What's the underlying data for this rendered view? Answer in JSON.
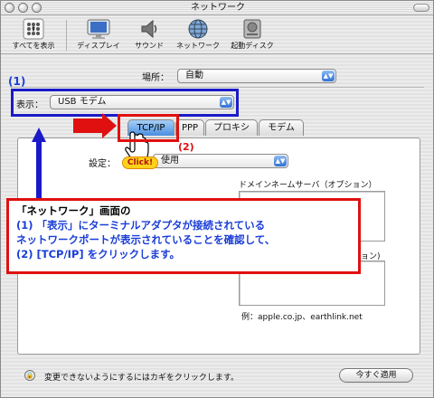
{
  "window": {
    "title": "ネットワーク"
  },
  "toolbar": {
    "show_all": "すべてを表示",
    "items": [
      {
        "label": "ディスプレイ",
        "icon": "display-icon"
      },
      {
        "label": "サウンド",
        "icon": "speaker-icon"
      },
      {
        "label": "ネットワーク",
        "icon": "network-globe-icon"
      },
      {
        "label": "起動ディスク",
        "icon": "startup-disk-icon"
      }
    ]
  },
  "location": {
    "label": "場所：",
    "value": "自動"
  },
  "show": {
    "label": "表示：",
    "value": "USB モデム"
  },
  "tabs": [
    "TCP/IP",
    "PPP",
    "プロキシ",
    "モデム"
  ],
  "settings": {
    "label": "設定：",
    "value": "使用"
  },
  "dns": {
    "label": "ドメインネームサーバ（オプション）"
  },
  "search_domain_tail": "ョン)",
  "example": "例：apple.co.jp、earthlink.net",
  "bottom": {
    "lock_text": "変更できないようにするにはカギをクリックします。",
    "apply_button": "今すぐ適用"
  },
  "annotations": {
    "step1": "(1)",
    "step2": "(2)",
    "click_badge": "Click!",
    "callout_line1": "「ネットワーク」画面の",
    "callout_line2": "(1) 「表示」にターミナルアダプタが接続されている",
    "callout_line3": "ネットワークポートが表示されていることを確認して、",
    "callout_line4": "(2) [TCP/IP] をクリックします。",
    "colors": {
      "blue": "#1a3ed8",
      "red": "#e01010",
      "badge": "#ffd21a"
    }
  }
}
